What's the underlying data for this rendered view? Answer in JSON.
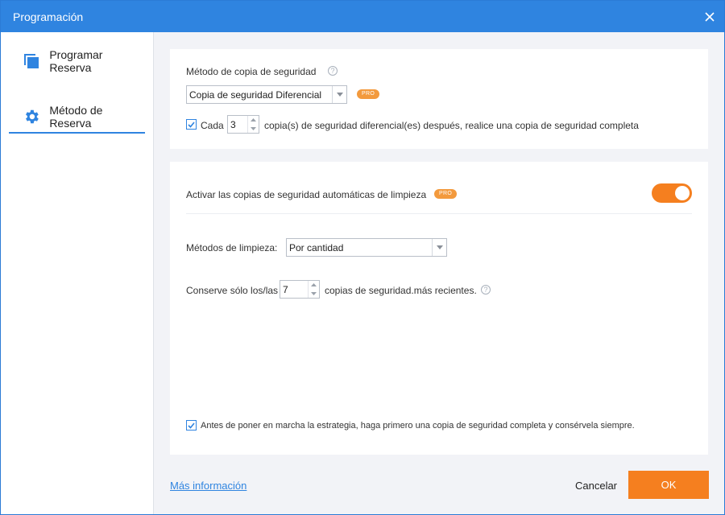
{
  "window": {
    "title": "Programación"
  },
  "sidebar": {
    "items": [
      {
        "label": "Programar Reserva",
        "icon": "copy-squares-icon"
      },
      {
        "label": "Método de Reserva",
        "icon": "gear-icon"
      }
    ],
    "active_index": 1
  },
  "backup_method": {
    "label": "Método de copia de seguridad",
    "help": "?",
    "select_value": "Copia de seguridad Diferencial",
    "pro_badge": "PRO",
    "every_checked": true,
    "every_label": "Cada",
    "every_value": "3",
    "every_suffix": "copia(s) de seguridad diferencial(es) después, realice una copia de seguridad completa"
  },
  "cleanup": {
    "enable_label": "Activar las copias de seguridad automáticas de limpieza",
    "pro_badge": "PRO",
    "enabled": true,
    "method_label": "Métodos de limpieza:",
    "method_value": "Por cantidad",
    "keep_prefix": "Conserve sólo los/las",
    "keep_value": "7",
    "keep_suffix": "copias de seguridad.más recientes.",
    "help": "?",
    "full_first_checked": true,
    "full_first_label": "Antes de poner en marcha la estrategia, haga primero una copia de seguridad completa y consérvela siempre."
  },
  "footer": {
    "more_info": "Más información",
    "cancel": "Cancelar",
    "ok": "OK"
  },
  "colors": {
    "titlebar": "#2f84e0",
    "accent": "#2f84e0",
    "orange": "#f57f1f"
  }
}
